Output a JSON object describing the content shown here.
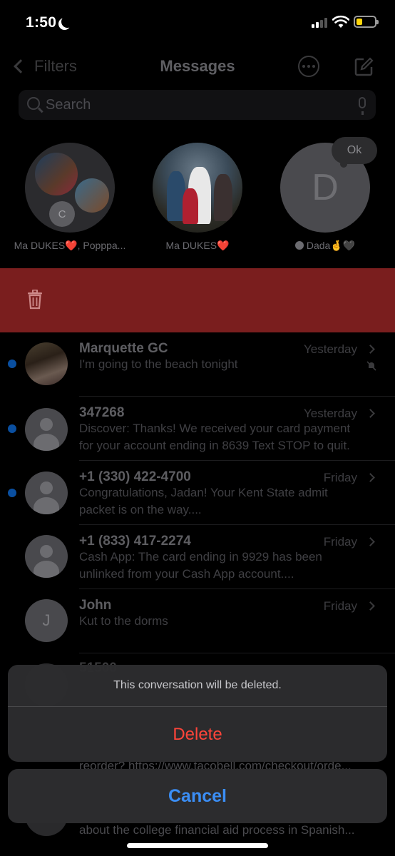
{
  "status": {
    "time": "1:50"
  },
  "nav": {
    "back_label": "Filters",
    "title": "Messages"
  },
  "search": {
    "placeholder": "Search"
  },
  "pinned": [
    {
      "label": "Ma DUKES❤️, Popppa...",
      "badge_initial": "C"
    },
    {
      "label": "Ma DUKES❤️"
    },
    {
      "label": "Dada🤞🖤",
      "initial": "D",
      "bubble": "Ok"
    }
  ],
  "conversations": [
    {
      "name": "Marquette GC",
      "time": "Yesterday",
      "preview_1": "I'm going to the beach tonight",
      "preview_2": "",
      "unread": true,
      "muted": true
    },
    {
      "name": "347268",
      "time": "Yesterday",
      "preview_1": "Discover: Thanks! We received your card payment",
      "preview_2": "for your account ending in 8639 Text STOP to quit.",
      "unread": true
    },
    {
      "name": "+1 (330) 422-4700",
      "time": "Friday",
      "preview_1": "Congratulations, Jadan! Your Kent State admit",
      "preview_2": "packet is on the way....",
      "unread": true
    },
    {
      "name": "+1 (833) 417-2274",
      "time": "Friday",
      "preview_1": "Cash App: The card ending in 9929 has been",
      "preview_2": "unlinked from your Cash App account....",
      "unread": false
    },
    {
      "name": "John",
      "time": "Friday",
      "preview_1": "Kut to the dorms",
      "preview_2": "",
      "initial": "J",
      "unread": false
    },
    {
      "name": "51500",
      "preview_tail": "reorder? https://www.tacobell.com/checkout/orde..."
    },
    {
      "preview_tail": "about the college financial aid process in Spanish..."
    }
  ],
  "action_sheet": {
    "message": "This conversation will be deleted.",
    "delete_label": "Delete",
    "cancel_label": "Cancel"
  },
  "colors": {
    "destructive": "#ff453a",
    "accent": "#3b8ef5",
    "swipe_delete_bg": "#7a1e1e",
    "unread_dot": "#0a4fa0"
  }
}
